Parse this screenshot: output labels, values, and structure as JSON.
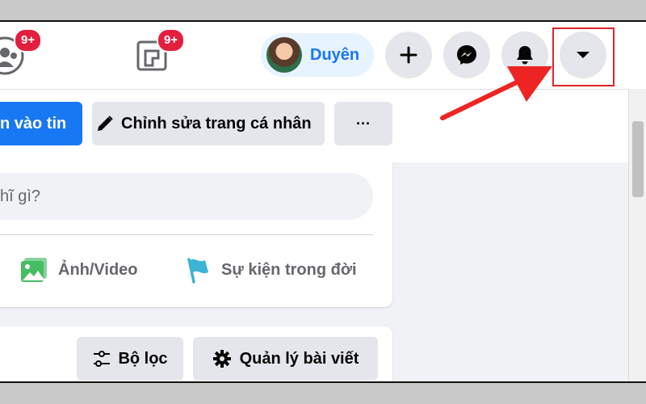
{
  "topbar": {
    "groups_badge": "9+",
    "gaming_badge": "9+",
    "profile_name": "Duyên",
    "icons": [
      "groups-icon",
      "gaming-icon",
      "plus-icon",
      "messenger-icon",
      "bell-icon",
      "caret-down-icon"
    ]
  },
  "profile_actions": {
    "add_story_label": "n vào tin",
    "edit_profile_label": "Chỉnh sửa trang cá nhân",
    "more_label": "···"
  },
  "composer": {
    "placeholder": "hĩ gì?",
    "photo_video_label": "Ảnh/Video",
    "life_event_label": "Sự kiện trong đời"
  },
  "posts_toolbar": {
    "filter_label": "Bộ lọc",
    "manage_posts_label": "Quản lý bài viết"
  },
  "colors": {
    "accent": "#1877f2",
    "badge": "#e41e3f",
    "highlight": "#e0242c",
    "photo_icon": "#45bd62",
    "event_icon": "#3ab3d4"
  }
}
